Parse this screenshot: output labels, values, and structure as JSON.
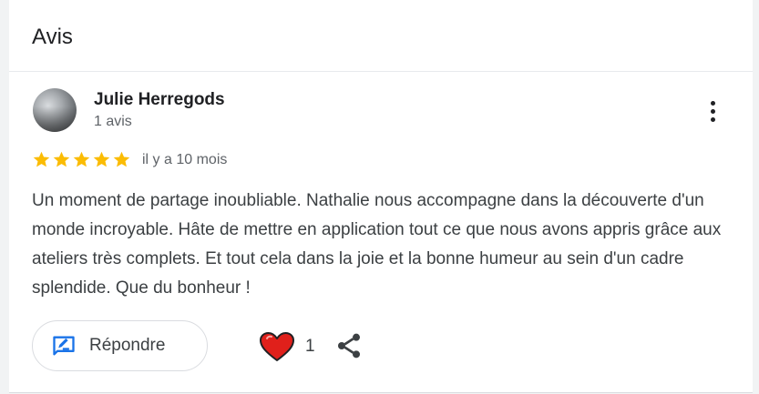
{
  "section": {
    "title": "Avis"
  },
  "review": {
    "author_name": "Julie Herregods",
    "author_meta": "1 avis",
    "rating": 5,
    "rating_max": 5,
    "time_ago": "il y a 10 mois",
    "text": "Un moment de partage inoubliable. Nathalie nous accompagne dans la découverte d'un monde incroyable. Hâte de mettre en application tout ce que nous avons appris grâce aux ateliers très complets. Et tout cela dans la joie et la bonne humeur au sein d'un cadre splendide. Que du bonheur !",
    "like_count": "1"
  },
  "actions": {
    "reply_label": "Répondre"
  },
  "icons": {
    "menu": "more-vert-icon",
    "star": "star-icon",
    "reply": "reply-edit-icon",
    "like": "heart-icon",
    "share": "share-icon"
  },
  "colors": {
    "star": "#fbbc04",
    "heart": "#e0201b",
    "reply_icon": "#1a73e8",
    "text": "#3c4043",
    "muted": "#5f6368"
  }
}
